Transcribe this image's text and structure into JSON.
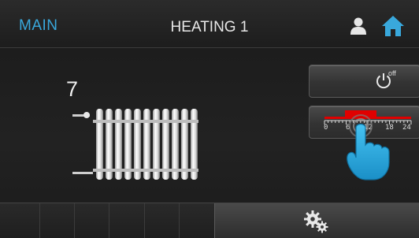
{
  "header": {
    "main_label": "MAIN",
    "title": "HEATING 1",
    "icons": [
      "user-icon",
      "home-icon"
    ]
  },
  "device": {
    "temperature_value": "7",
    "icon": "radiator-icon"
  },
  "power_button": {
    "icon": "power-icon",
    "label": "off"
  },
  "schedule_button": {
    "icon": "timeline-icon",
    "tick_labels": [
      "0",
      "6",
      "12",
      "18",
      "24"
    ]
  },
  "settings_button": {
    "icon": "gears-icon"
  },
  "colors": {
    "accent": "#39a8dc",
    "schedule_bar": "#e00000",
    "background": "#1c1c1c"
  }
}
